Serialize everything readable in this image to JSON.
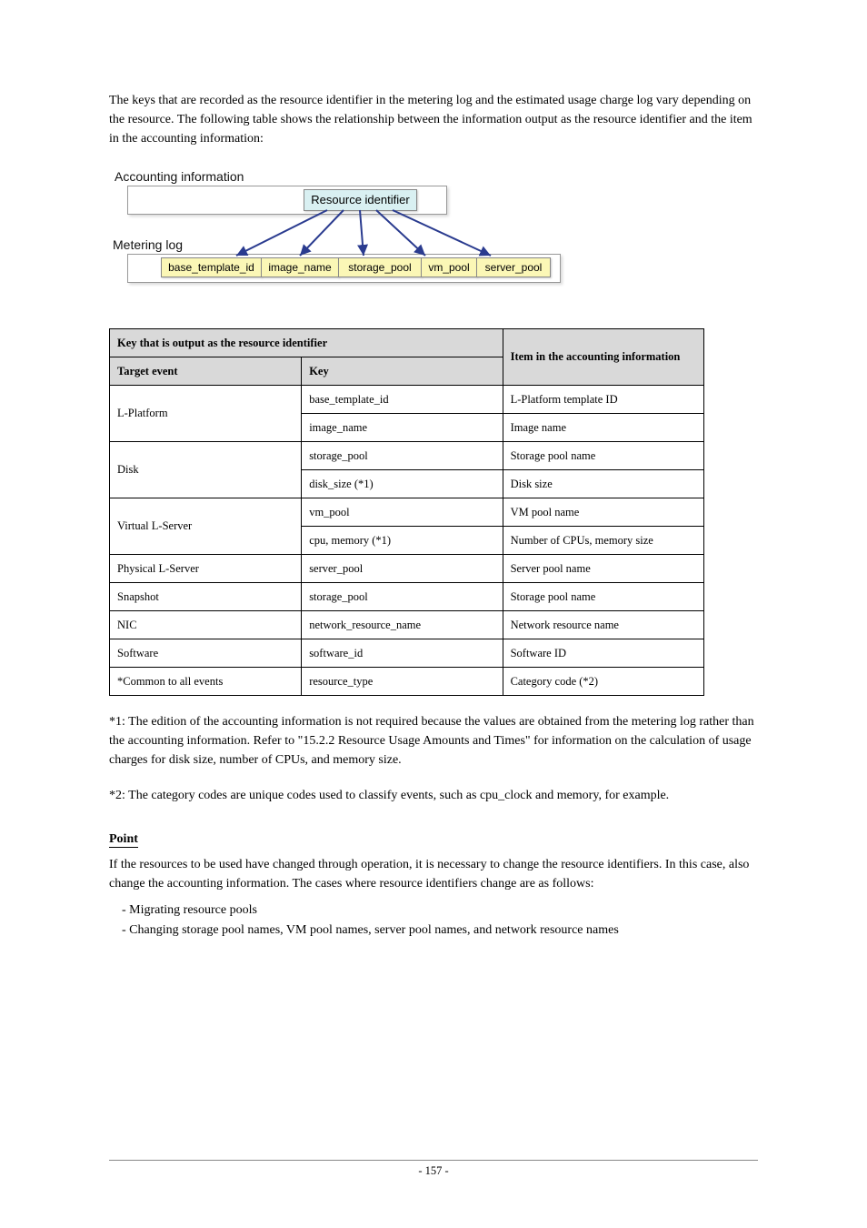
{
  "intro": {
    "p1": "The keys that are recorded as the resource identifier in the metering log and the estimated usage charge log vary depending on the resource. The following table shows the relationship between the information output as the resource identifier and the item in the accounting information:"
  },
  "diagram": {
    "top_label": "Accounting information",
    "resource_box": "Resource identifier",
    "mid_label": "Metering log",
    "cells": [
      "base_template_id",
      "image_name",
      "storage_pool",
      "vm_pool",
      "server_pool"
    ]
  },
  "table": {
    "head_left": "Key that is output as the resource identifier",
    "head_right": "Item in the accounting information",
    "sub_event": "Target event",
    "sub_key": "Key",
    "rows": [
      {
        "event": "L-Platform",
        "key": "base_template_id",
        "item": "L-Platform template ID",
        "rowspan": 2
      },
      {
        "key": "image_name",
        "item": "Image name"
      },
      {
        "event": "Disk",
        "key": "storage_pool",
        "item": "Storage pool name",
        "rowspan": 2
      },
      {
        "key": "disk_size (*1)",
        "item": "Disk size"
      },
      {
        "event": "Virtual L-Server",
        "key": "vm_pool",
        "item": "VM pool name",
        "rowspan": 2
      },
      {
        "key": "cpu, memory (*1)",
        "item": "Number of CPUs, memory size"
      },
      {
        "event": "Physical L-Server",
        "key": "server_pool",
        "item": "Server pool name"
      },
      {
        "event": "Snapshot",
        "key": "storage_pool",
        "item": "Storage pool name"
      },
      {
        "event": "NIC",
        "key": "network_resource_name",
        "item": "Network resource name"
      },
      {
        "event": "Software",
        "key": "software_id",
        "item": "Software ID"
      },
      {
        "event": "*Common to all events",
        "key": "resource_type",
        "item": "Category code (*2)"
      }
    ]
  },
  "post": {
    "note1": "*1: The edition of the accounting information is not required because the values are obtained from the metering log rather than the accounting information. Refer to \"15.2.2 Resource Usage Amounts and Times\" for information on the calculation of usage charges for disk size, number of CPUs, and memory size.",
    "note2": "*2: The category codes are unique codes used to classify events, such as cpu_clock and memory, for example."
  },
  "point": {
    "label": "Point",
    "desc": "If the resources to be used have changed through operation, it is necessary to change the resource identifiers. In this case, also change the accounting information. The cases where resource identifiers change are as follows:",
    "items": [
      "- Migrating resource pools",
      "- Changing storage pool names, VM pool names, server pool names, and network resource names"
    ]
  },
  "footer": {
    "left": "",
    "center": "- 157 -",
    "right": ""
  }
}
